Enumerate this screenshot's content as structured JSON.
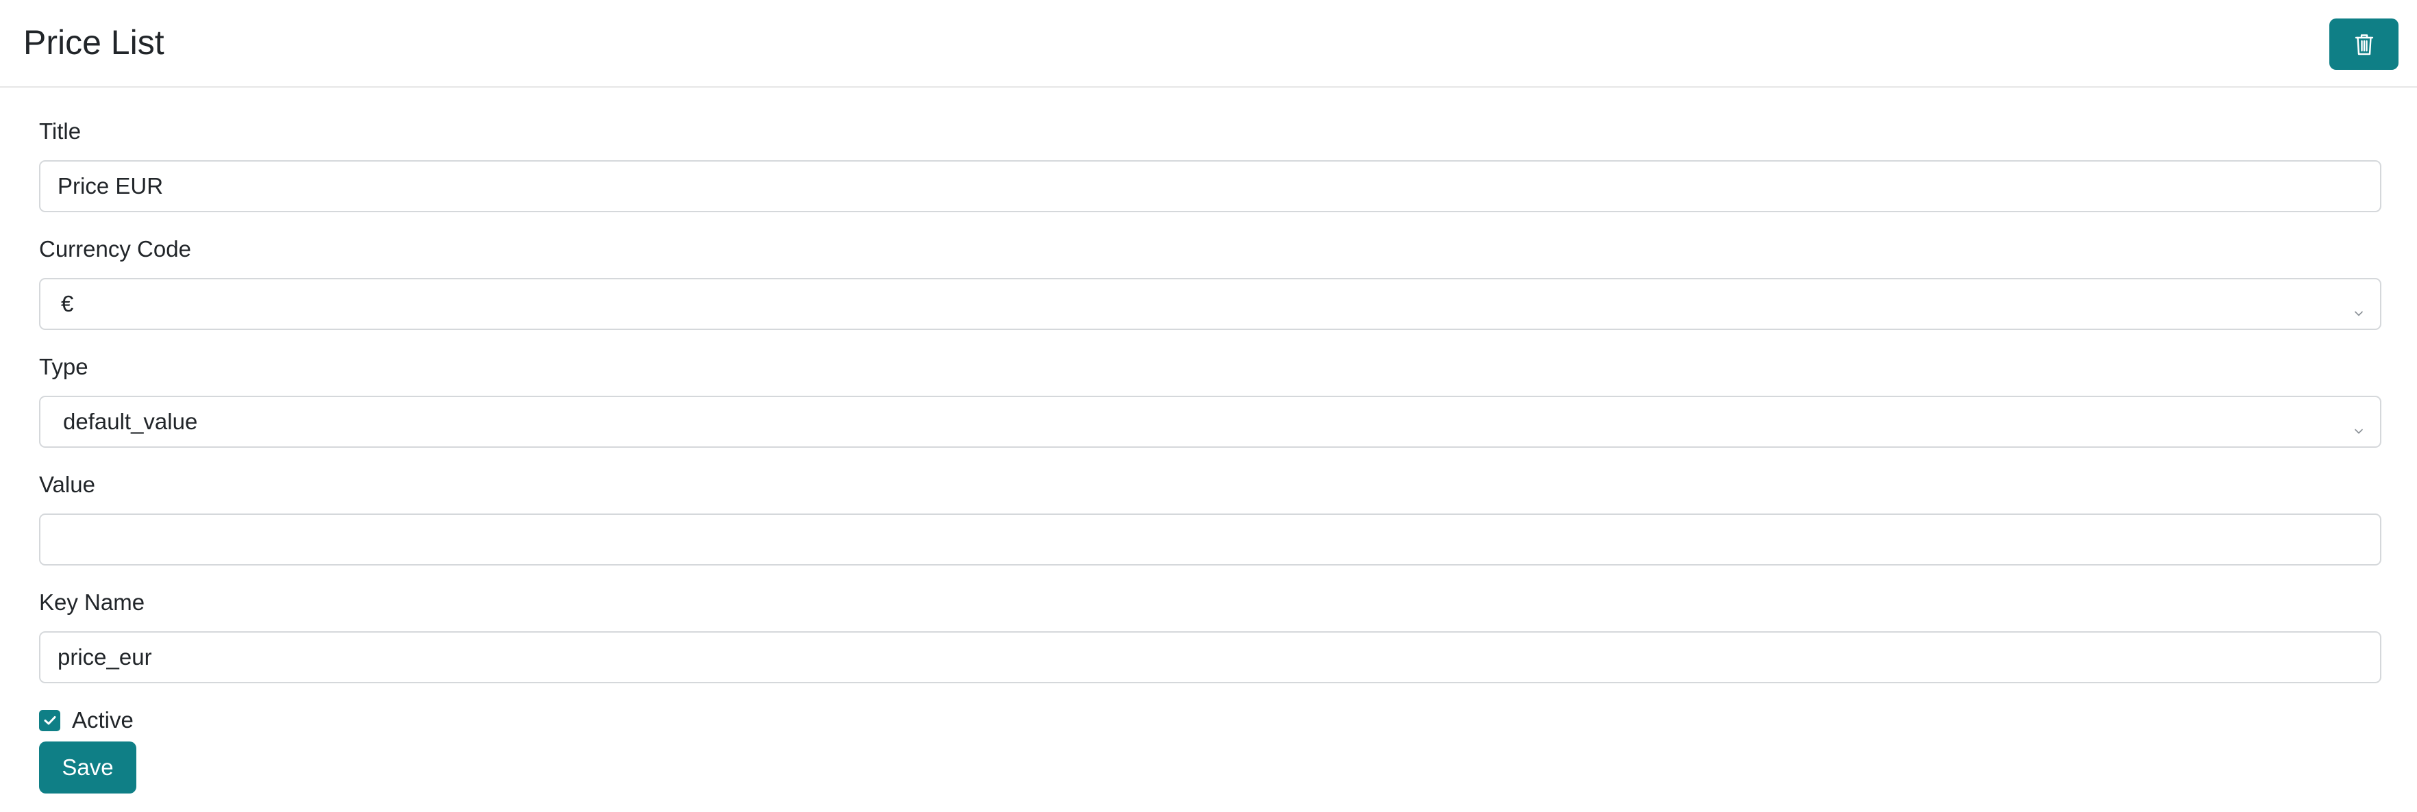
{
  "header": {
    "title": "Price List",
    "delete_icon": "trash-icon"
  },
  "form": {
    "title": {
      "label": "Title",
      "value": "Price EUR"
    },
    "currency_code": {
      "label": "Currency Code",
      "value": "€"
    },
    "type": {
      "label": "Type",
      "value": "default_value"
    },
    "value": {
      "label": "Value",
      "value": ""
    },
    "key_name": {
      "label": "Key Name",
      "value": "price_eur"
    },
    "active": {
      "label": "Active",
      "checked": true
    },
    "save_label": "Save"
  },
  "colors": {
    "accent": "#0f7f86",
    "border": "#d5d8db",
    "text": "#212529"
  }
}
